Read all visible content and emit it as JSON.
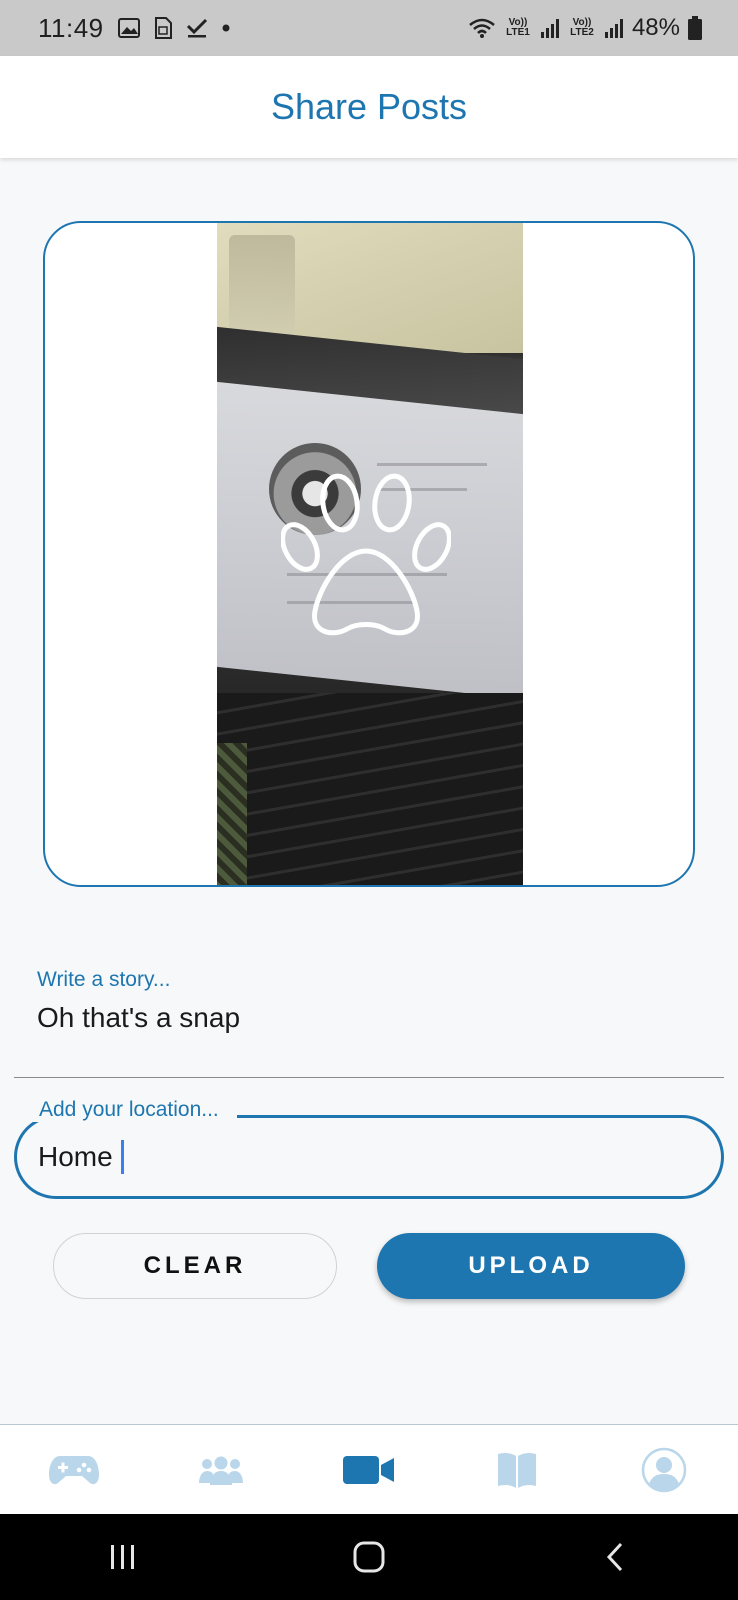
{
  "status_bar": {
    "time": "11:49",
    "battery": "48%",
    "network_1": "Vo)) LTE1",
    "network_2": "Vo)) LTE2",
    "icons_left": [
      "image-icon",
      "sim-card-icon",
      "check-icon",
      "dot-icon"
    ],
    "icons_right": [
      "wifi-icon",
      "signal-icon",
      "signal-icon",
      "battery-icon"
    ]
  },
  "header": {
    "title": "Share Posts"
  },
  "media": {
    "overlay_icon": "paw-icon"
  },
  "form": {
    "story_label": "Write a story...",
    "story_value": "Oh that's a snap",
    "location_label": "Add your location...",
    "location_value": "Home"
  },
  "buttons": {
    "clear_label": "CLEAR",
    "upload_label": "UPLOAD"
  },
  "bottom_nav": {
    "items": [
      {
        "icon": "gamepad-icon",
        "active": false
      },
      {
        "icon": "users-icon",
        "active": false
      },
      {
        "icon": "video-camera-icon",
        "active": true
      },
      {
        "icon": "book-icon",
        "active": false
      },
      {
        "icon": "profile-icon",
        "active": false
      }
    ]
  },
  "system_nav": {
    "items": [
      "recent-apps-icon",
      "home-icon",
      "back-icon"
    ]
  },
  "colors": {
    "accent": "#1e76b0",
    "nav_inactive": "#b9d6ea",
    "background": "#f7f8f9"
  }
}
